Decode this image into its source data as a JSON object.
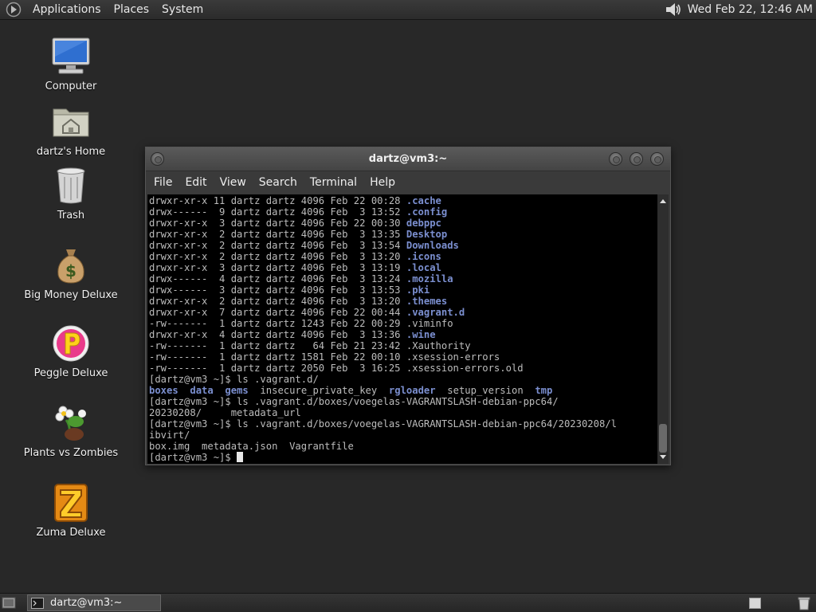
{
  "top_panel": {
    "menus": [
      "Applications",
      "Places",
      "System"
    ],
    "clock": "Wed Feb 22, 12:46 AM"
  },
  "desktop_icons": [
    {
      "label": "Computer",
      "icon": "computer-icon"
    },
    {
      "label": "dartz's Home",
      "icon": "home-folder-icon"
    },
    {
      "label": "Trash",
      "icon": "trash-icon"
    },
    {
      "label": "Big Money Deluxe",
      "icon": "money-bag-icon"
    },
    {
      "label": "Peggle Deluxe",
      "icon": "peggle-icon"
    },
    {
      "label": "Plants vs Zombies",
      "icon": "plants-vs-zombies-icon"
    },
    {
      "label": "Zuma Deluxe",
      "icon": "zuma-icon"
    }
  ],
  "terminal": {
    "title": "dartz@vm3:~",
    "menu": [
      "File",
      "Edit",
      "View",
      "Search",
      "Terminal",
      "Help"
    ],
    "lines": [
      {
        "text": "drwxr-xr-x 11 dartz dartz 4096 Feb 22 00:28 ",
        "name": ".cache",
        "dir": true
      },
      {
        "text": "drwx------  9 dartz dartz 4096 Feb  3 13:52 ",
        "name": ".config",
        "dir": true
      },
      {
        "text": "drwxr-xr-x  3 dartz dartz 4096 Feb 22 00:30 ",
        "name": "debppc",
        "dir": true
      },
      {
        "text": "drwxr-xr-x  2 dartz dartz 4096 Feb  3 13:35 ",
        "name": "Desktop",
        "dir": true
      },
      {
        "text": "drwxr-xr-x  2 dartz dartz 4096 Feb  3 13:54 ",
        "name": "Downloads",
        "dir": true
      },
      {
        "text": "drwxr-xr-x  2 dartz dartz 4096 Feb  3 13:20 ",
        "name": ".icons",
        "dir": true
      },
      {
        "text": "drwxr-xr-x  3 dartz dartz 4096 Feb  3 13:19 ",
        "name": ".local",
        "dir": true
      },
      {
        "text": "drwx------  4 dartz dartz 4096 Feb  3 13:24 ",
        "name": ".mozilla",
        "dir": true
      },
      {
        "text": "drwx------  3 dartz dartz 4096 Feb  3 13:53 ",
        "name": ".pki",
        "dir": true
      },
      {
        "text": "drwxr-xr-x  2 dartz dartz 4096 Feb  3 13:20 ",
        "name": ".themes",
        "dir": true
      },
      {
        "text": "drwxr-xr-x  7 dartz dartz 4096 Feb 22 00:44 ",
        "name": ".vagrant.d",
        "dir": true
      },
      {
        "text": "-rw-------  1 dartz dartz 1243 Feb 22 00:29 ",
        "name": ".viminfo",
        "dir": false
      },
      {
        "text": "drwxr-xr-x  4 dartz dartz 4096 Feb  3 13:36 ",
        "name": ".wine",
        "dir": true
      },
      {
        "text": "-rw-------  1 dartz dartz   64 Feb 21 23:42 ",
        "name": ".Xauthority",
        "dir": false
      },
      {
        "text": "-rw-------  1 dartz dartz 1581 Feb 22 00:10 ",
        "name": ".xsession-errors",
        "dir": false
      },
      {
        "text": "-rw-------  1 dartz dartz 2050 Feb  3 16:25 ",
        "name": ".xsession-errors.old",
        "dir": false
      },
      {
        "text": "[dartz@vm3 ~]$ ls .vagrant.d/",
        "name": "",
        "dir": false
      },
      {
        "segments": [
          {
            "t": "boxes",
            "d": true
          },
          {
            "t": "  ",
            "d": false
          },
          {
            "t": "data",
            "d": true
          },
          {
            "t": "  ",
            "d": false
          },
          {
            "t": "gems",
            "d": true
          },
          {
            "t": "  insecure_private_key  ",
            "d": false
          },
          {
            "t": "rgloader",
            "d": true
          },
          {
            "t": "  setup_version  ",
            "d": false
          },
          {
            "t": "tmp",
            "d": true
          }
        ]
      },
      {
        "text": "[dartz@vm3 ~]$ ls .vagrant.d/boxes/voegelas-VAGRANTSLASH-debian-ppc64/",
        "name": "",
        "dir": false
      },
      {
        "text": "20230208/     metadata_url",
        "name": "",
        "dir": false
      },
      {
        "text": "[dartz@vm3 ~]$ ls .vagrant.d/boxes/voegelas-VAGRANTSLASH-debian-ppc64/20230208/l",
        "name": "",
        "dir": false
      },
      {
        "text": "ibvirt/",
        "name": "",
        "dir": false
      },
      {
        "text": "box.img  metadata.json  Vagrantfile",
        "name": "",
        "dir": false
      },
      {
        "text": "[dartz@vm3 ~]$ ",
        "name": "",
        "dir": false,
        "cursor": true
      }
    ]
  },
  "bottom_panel": {
    "task_label": "dartz@vm3:~"
  }
}
